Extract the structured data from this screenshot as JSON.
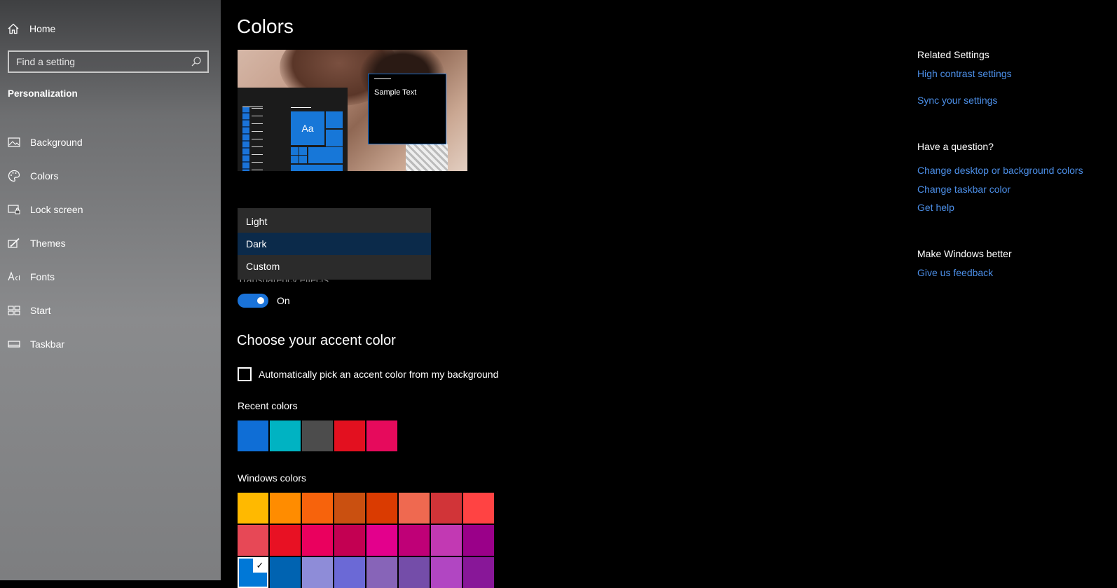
{
  "sidebar": {
    "home_label": "Home",
    "search_placeholder": "Find a setting",
    "section_title": "Personalization",
    "items": [
      {
        "label": "Background",
        "icon": "picture-icon"
      },
      {
        "label": "Colors",
        "icon": "palette-icon"
      },
      {
        "label": "Lock screen",
        "icon": "lock-screen-icon"
      },
      {
        "label": "Themes",
        "icon": "brush-icon"
      },
      {
        "label": "Fonts",
        "icon": "font-icon"
      },
      {
        "label": "Start",
        "icon": "start-icon"
      },
      {
        "label": "Taskbar",
        "icon": "taskbar-icon"
      }
    ]
  },
  "main": {
    "title": "Colors",
    "preview": {
      "tile_text": "Aa",
      "sample_text": "Sample Text"
    },
    "mode_dropdown": {
      "options": [
        "Light",
        "Dark",
        "Custom"
      ],
      "selected": "Dark"
    },
    "transparency": {
      "label": "Transparency effects",
      "state": "On"
    },
    "accent": {
      "title": "Choose your accent color",
      "auto_pick_label": "Automatically pick an accent color from my background",
      "auto_pick_checked": false,
      "recent_label": "Recent colors",
      "recent_colors": [
        "#0f6ed6",
        "#00b3c2",
        "#4c4c4c",
        "#e3101f",
        "#e60a5c"
      ],
      "windows_label": "Windows colors",
      "windows_colors": [
        "#ffb900",
        "#ff8c00",
        "#f7630c",
        "#ca5010",
        "#da3b01",
        "#ef6950",
        "#d13438",
        "#ff4343",
        "#e74856",
        "#e81123",
        "#ea005e",
        "#c30052",
        "#e3008c",
        "#bf0077",
        "#c239b3",
        "#9a0089",
        "#0078d7",
        "#0063b1",
        "#8e8cd8",
        "#6b69d6",
        "#8764b8",
        "#744da9",
        "#b146c2",
        "#881798"
      ],
      "selected_windows_color": "#0078d7"
    }
  },
  "related": {
    "heading": "Related Settings",
    "links": [
      "High contrast settings",
      "Sync your settings"
    ],
    "question_heading": "Have a question?",
    "question_links": [
      "Change desktop or background colors",
      "Change taskbar color",
      "Get help"
    ],
    "feedback_heading": "Make Windows better",
    "feedback_link": "Give us feedback",
    "link_color": "#4c8fe8"
  }
}
